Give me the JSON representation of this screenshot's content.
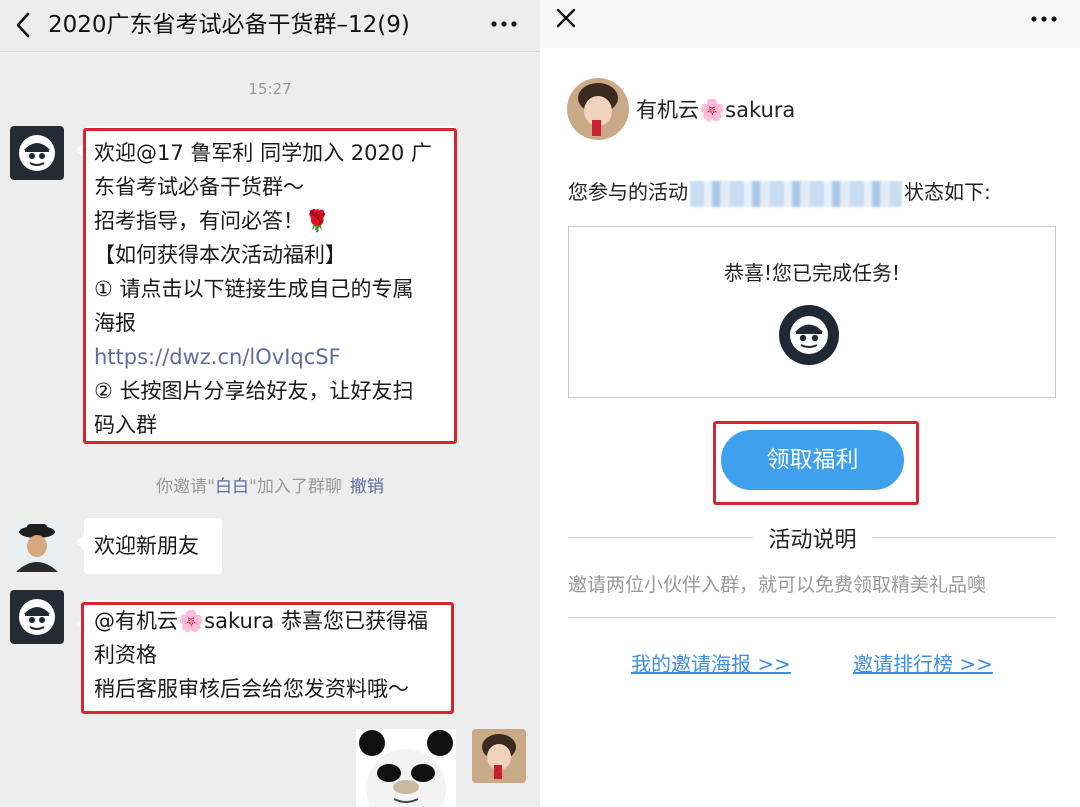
{
  "chat": {
    "title": "2020广东省考试必备干货群–12(9)",
    "time": "15:27",
    "messages": [
      {
        "lines": [
          "欢迎@17 鲁军利  同学加入 2020 广",
          "东省考试必备干货群～",
          "招考指导，有问必答！🌹",
          "【如何获得本次活动福利】",
          "① 请点击以下链接生成自己的专属",
          "海报"
        ],
        "link": "https://dwz.cn/lOvIqcSF",
        "tail_lines": [
          "② 长按图片分享给好友，让好友扫",
          "码入群"
        ]
      },
      {
        "text": "欢迎新朋友"
      },
      {
        "lines": [
          "@有机云🌸sakura 恭喜您已获得福",
          "利资格",
          "稍后客服审核后会给您发资料哦～"
        ]
      }
    ],
    "system": {
      "prefix": "你邀请\"",
      "name": "白白",
      "suffix": "\"加入了群聊",
      "undo": "撤销"
    }
  },
  "webview": {
    "user_name": "有机云🌸sakura",
    "status_prefix": "您参与的活动",
    "status_suffix": "状态如下:",
    "result_text": "恭喜!您已完成任务!",
    "claim_button": "领取福利",
    "section_title": "活动说明",
    "description": "邀请两位小伙伴入群，就可以免费领取精美礼品噢",
    "links": {
      "poster": "我的邀请海报 >>",
      "ranking": "邀请排行榜 >>"
    }
  },
  "colors": {
    "highlight_border": "#d8252f",
    "button": "#3fa0ee",
    "link": "#3d8fe6"
  }
}
